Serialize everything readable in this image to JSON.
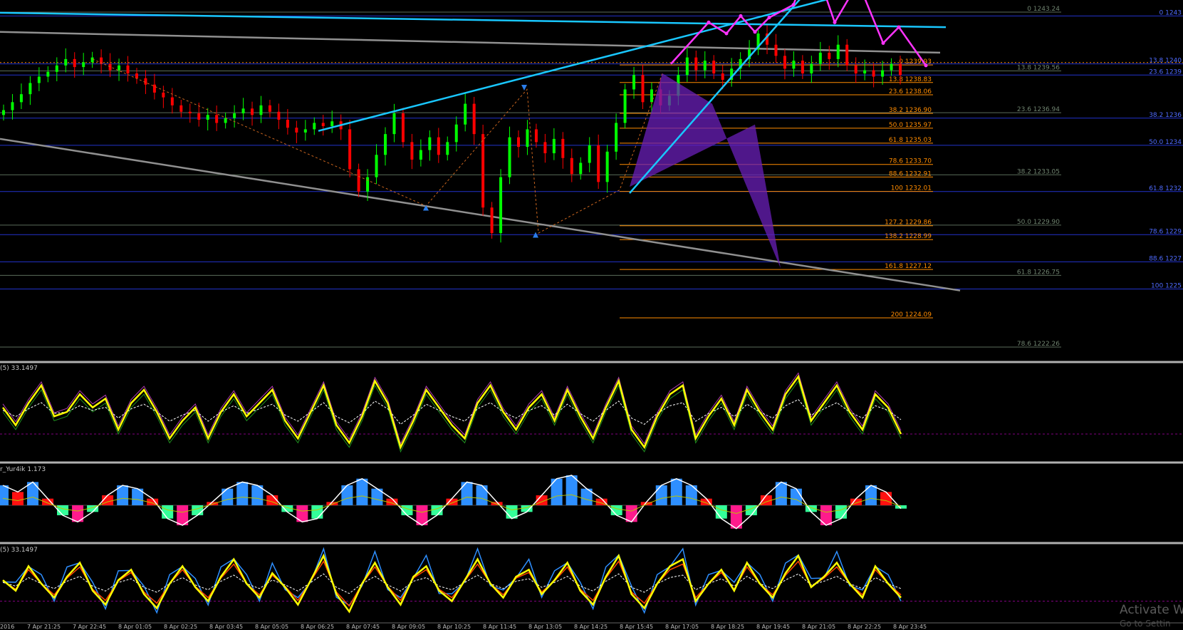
{
  "chart_data": {
    "type": "candlestick",
    "main_panel": {
      "fib_retracement_right_labels": [
        {
          "label": "0 1243",
          "level": 1243.0
        },
        {
          "label": "13.8 1240",
          "level": 1240.0
        },
        {
          "label": "23.6 1239",
          "level": 1239.3
        },
        {
          "label": "38.2 1236",
          "level": 1236.6
        },
        {
          "label": "50.0 1234",
          "level": 1234.9
        },
        {
          "label": "61.8 1232",
          "level": 1232.0
        },
        {
          "label": "78.6 1229",
          "level": 1229.3
        },
        {
          "label": "88.6 1227",
          "level": 1227.6
        },
        {
          "label": "100 1225",
          "level": 1225.9
        }
      ],
      "fib_grey_labels": [
        {
          "label": "0 1243.24",
          "level": 1243.24
        },
        {
          "label": "13.8 1239.56",
          "level": 1239.56
        },
        {
          "label": "23.6 1236.94",
          "level": 1236.94
        },
        {
          "label": "38.2 1233.05",
          "level": 1233.05
        },
        {
          "label": "50.0 1229.90",
          "level": 1229.9
        },
        {
          "label": "61.8 1226.75",
          "level": 1226.75
        },
        {
          "label": "78.6 1222.26",
          "level": 1222.26
        }
      ],
      "fib_orange_labels": [
        {
          "label": "0 1239.93",
          "level": 1239.93
        },
        {
          "label": "13.8 1238.83",
          "level": 1238.83
        },
        {
          "label": "23.6 1238.06",
          "level": 1238.06
        },
        {
          "label": "38.2 1236.90",
          "level": 1236.9
        },
        {
          "label": "50.0 1235.97",
          "level": 1235.97
        },
        {
          "label": "61.8 1235.03",
          "level": 1235.03
        },
        {
          "label": "78.6 1233.70",
          "level": 1233.7
        },
        {
          "label": "88.6 1232.91",
          "level": 1232.91
        },
        {
          "label": "100 1232.01",
          "level": 1232.01
        },
        {
          "label": "127.2 1229.86",
          "level": 1229.86
        },
        {
          "label": "138.2 1228.99",
          "level": 1228.99
        },
        {
          "label": "161.8 1227.12",
          "level": 1227.12
        },
        {
          "label": "200 1224.09",
          "level": 1224.09
        }
      ],
      "close_series": [
        1237.1,
        1237.6,
        1238.1,
        1238.8,
        1239.2,
        1239.5,
        1239.9,
        1240.3,
        1239.8,
        1240.1,
        1240.4,
        1240.0,
        1239.6,
        1239.9,
        1239.4,
        1239.1,
        1238.7,
        1238.2,
        1237.9,
        1237.4,
        1237.0,
        1236.9,
        1236.5,
        1236.8,
        1236.3,
        1236.6,
        1236.9,
        1237.2,
        1236.8,
        1237.4,
        1237.0,
        1236.5,
        1236.0,
        1235.7,
        1235.9,
        1236.3,
        1236.1,
        1236.4,
        1235.9,
        1233.4,
        1232.0,
        1232.9,
        1234.3,
        1235.6,
        1236.9,
        1235.1,
        1234.0,
        1234.6,
        1235.4,
        1234.3,
        1235.1,
        1236.2,
        1237.5,
        1235.6,
        1231.0,
        1229.4,
        1232.9,
        1235.4,
        1234.8,
        1235.9,
        1235.1,
        1234.4,
        1235.3,
        1234.1,
        1233.1,
        1233.8,
        1234.9,
        1232.6,
        1234.5,
        1236.3,
        1238.4,
        1239.3,
        1237.6,
        1238.4,
        1237.4,
        1238.0,
        1239.3,
        1240.4,
        1239.6,
        1240.2,
        1239.4,
        1239.0,
        1239.7,
        1240.3,
        1240.9,
        1241.9,
        1241.2,
        1240.5,
        1239.7,
        1240.2,
        1239.4,
        1240.0,
        1240.7,
        1240.3,
        1241.2,
        1239.9,
        1239.4,
        1239.6,
        1239.2,
        1239.6,
        1240.0,
        1239.3
      ]
    },
    "oscillator_1": {
      "title": "(5) 33.1497",
      "values": [
        0.55,
        0.35,
        0.6,
        0.8,
        0.45,
        0.5,
        0.7,
        0.55,
        0.65,
        0.3,
        0.6,
        0.75,
        0.5,
        0.2,
        0.4,
        0.55,
        0.2,
        0.5,
        0.7,
        0.45,
        0.6,
        0.75,
        0.4,
        0.2,
        0.5,
        0.8,
        0.35,
        0.15,
        0.45,
        0.85,
        0.6,
        0.1,
        0.4,
        0.75,
        0.55,
        0.35,
        0.2,
        0.6,
        0.8,
        0.5,
        0.3,
        0.55,
        0.7,
        0.4,
        0.75,
        0.45,
        0.2,
        0.55,
        0.85,
        0.3,
        0.1,
        0.45,
        0.7,
        0.8,
        0.2,
        0.45,
        0.65,
        0.35,
        0.75,
        0.5,
        0.3,
        0.7,
        0.9,
        0.4,
        0.6,
        0.8,
        0.5,
        0.3,
        0.7,
        0.55,
        0.25
      ]
    },
    "oscillator_2": {
      "title": "r_Yur4ik 1.173",
      "values": [
        0.6,
        0.4,
        0.7,
        0.2,
        -0.3,
        -0.5,
        -0.2,
        0.3,
        0.6,
        0.5,
        0.2,
        -0.4,
        -0.6,
        -0.3,
        0.1,
        0.5,
        0.7,
        0.6,
        0.3,
        -0.2,
        -0.5,
        -0.4,
        0.1,
        0.6,
        0.8,
        0.5,
        0.2,
        -0.3,
        -0.6,
        -0.3,
        0.2,
        0.7,
        0.6,
        0.1,
        -0.4,
        -0.2,
        0.3,
        0.8,
        0.9,
        0.5,
        0.2,
        -0.3,
        -0.5,
        0.1,
        0.6,
        0.8,
        0.6,
        0.2,
        -0.4,
        -0.7,
        -0.3,
        0.3,
        0.7,
        0.5,
        -0.2,
        -0.6,
        -0.4,
        0.2,
        0.6,
        0.4,
        -0.1
      ]
    },
    "oscillator_3": {
      "title": "(5) 33.1497",
      "values": [
        0.55,
        0.4,
        0.75,
        0.5,
        0.3,
        0.6,
        0.8,
        0.4,
        0.2,
        0.55,
        0.7,
        0.35,
        0.15,
        0.5,
        0.75,
        0.45,
        0.25,
        0.6,
        0.85,
        0.5,
        0.3,
        0.65,
        0.45,
        0.2,
        0.55,
        0.9,
        0.35,
        0.1,
        0.5,
        0.8,
        0.45,
        0.2,
        0.6,
        0.75,
        0.4,
        0.25,
        0.55,
        0.85,
        0.5,
        0.3,
        0.6,
        0.7,
        0.35,
        0.55,
        0.8,
        0.4,
        0.2,
        0.6,
        0.9,
        0.35,
        0.15,
        0.5,
        0.75,
        0.85,
        0.25,
        0.5,
        0.7,
        0.4,
        0.8,
        0.5,
        0.3,
        0.65,
        0.9,
        0.45,
        0.6,
        0.8,
        0.5,
        0.3,
        0.75,
        0.5,
        0.3
      ]
    },
    "x_tick_labels": [
      "2016",
      "7 Apr 21:25",
      "7 Apr 22:45",
      "8 Apr 01:05",
      "8 Apr 02:25",
      "8 Apr 03:45",
      "8 Apr 05:05",
      "8 Apr 06:25",
      "8 Apr 07:45",
      "8 Apr 09:05",
      "8 Apr 10:25",
      "8 Apr 11:45",
      "8 Apr 13:05",
      "8 Apr 14:25",
      "8 Apr 15:45",
      "8 Apr 17:05",
      "8 Apr 18:25",
      "8 Apr 19:45",
      "8 Apr 21:05",
      "8 Apr 22:25",
      "8 Apr 23:45"
    ],
    "colors": {
      "bull": "#00ff00",
      "bear": "#ff0000",
      "blue_line": "#2233cc",
      "orange_fib": "#ff8c00",
      "grey_fib": "#5b6d5b",
      "cyan": "#19c7ff",
      "magenta": "#ff33ff",
      "purple": "#6a1fb8",
      "grey_trend": "#909090",
      "yellow": "#ffff00"
    }
  },
  "watermark": {
    "line1": "Activate W",
    "line2": "Go to Settin"
  }
}
